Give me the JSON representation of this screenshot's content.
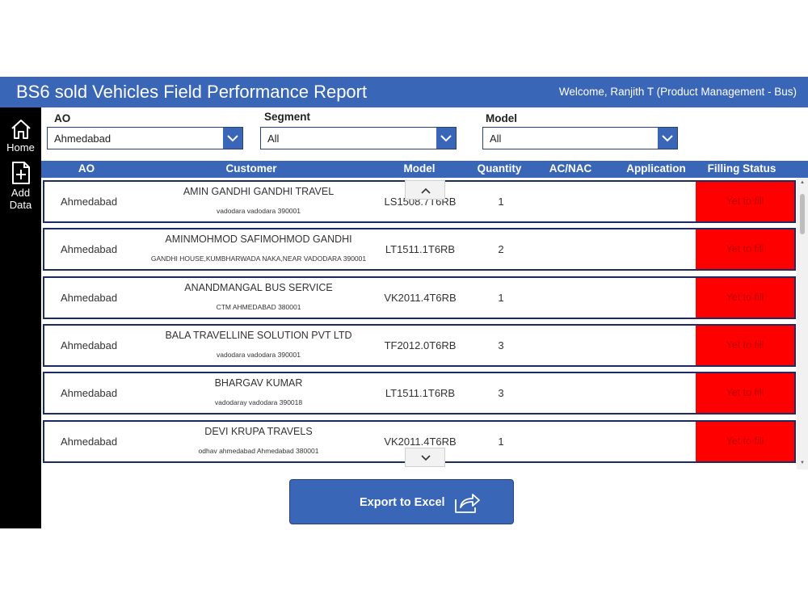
{
  "header": {
    "title": "BS6 sold Vehicles Field Performance Report",
    "welcome": "Welcome, Ranjith T (Product Management - Bus)"
  },
  "sidebar": {
    "items": [
      {
        "label": "Home",
        "icon": "home-icon"
      },
      {
        "label_line1": "Add",
        "label_line2": "Data",
        "icon": "add-document-icon"
      }
    ]
  },
  "filters": {
    "ao": {
      "label": "AO",
      "value": "Ahmedabad"
    },
    "segment": {
      "label": "Segment",
      "value": "All"
    },
    "model": {
      "label": "Model",
      "value": "All"
    }
  },
  "table": {
    "columns": [
      "AO",
      "Customer",
      "Model",
      "Quantity",
      "AC/NAC",
      "Application",
      "Filling Status"
    ],
    "rows": [
      {
        "ao": "Ahmedabad",
        "customer_name": "AMIN GANDHI GANDHI TRAVEL",
        "customer_address": "vadodara vadodara  390001",
        "model": "LS1508.7T6RB",
        "quantity": "1",
        "status": "Yet to fill"
      },
      {
        "ao": "Ahmedabad",
        "customer_name": "AMINMOHMOD SAFIMOHMOD GANDHI",
        "customer_address": "GANDHI HOUSE,KUMBHARWADA NAKA,NEAR VADODARA  390001",
        "model": "LT1511.1T6RB",
        "quantity": "2",
        "status": "Yet to fill"
      },
      {
        "ao": "Ahmedabad",
        "customer_name": "ANANDMANGAL BUS SERVICE",
        "customer_address": "CTM AHMEDABAD  380001",
        "model": "VK2011.4T6RB",
        "quantity": "1",
        "status": "Yet to fill"
      },
      {
        "ao": "Ahmedabad",
        "customer_name": "BALA TRAVELLINE SOLUTION PVT  LTD",
        "customer_address": "vadodara vadodara  390001",
        "model": "TF2012.0T6RB",
        "quantity": "3",
        "status": "Yet to fill"
      },
      {
        "ao": "Ahmedabad",
        "customer_name": "BHARGAV KUMAR",
        "customer_address": "vadodaray vadodara  390018",
        "model": "LT1511.1T6RB",
        "quantity": "3",
        "status": "Yet to fill"
      },
      {
        "ao": "Ahmedabad",
        "customer_name": "DEVI KRUPA TRAVELS",
        "customer_address": "odhav ahmedabad Ahmedabad  380001",
        "model": "VK2011.4T6RB",
        "quantity": "1",
        "status": "Yet to fill"
      }
    ]
  },
  "export_button": {
    "label": "Export to Excel",
    "icon": "share-export-icon"
  },
  "colors": {
    "primary": "#3a66b8",
    "sidebar": "#000000",
    "status_bg": "#ff0000",
    "row_border": "#1c2b62"
  }
}
